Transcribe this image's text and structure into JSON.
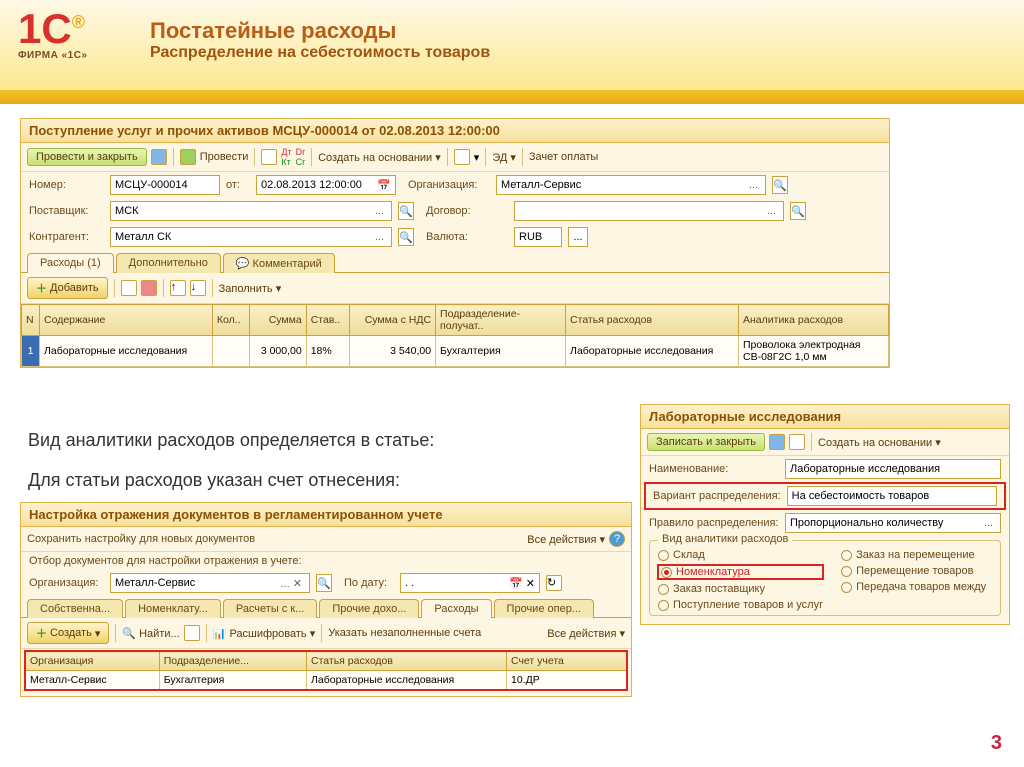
{
  "logo_sub": "ФИРМА «1С»",
  "slide": {
    "title1": "Постатейные расходы",
    "title2": "Распределение на себестоимость товаров",
    "text1": "Вид аналитики расходов определяется в статье:",
    "text2": "Для статьи расходов указан счет отнесения:",
    "page": "3"
  },
  "doc": {
    "title": "Поступление услуг и прочих активов МСЦУ-000014 от 02.08.2013 12:00:00",
    "btn_main": "Провести и закрыть",
    "btn_provesti": "Провести",
    "btn_create": "Создать на основании",
    "btn_ed": "ЭД",
    "btn_zachet": "Зачет оплаты",
    "lbl_number": "Номер:",
    "number": "МСЦУ-000014",
    "lbl_ot": "от:",
    "date": "02.08.2013 12:00:00",
    "lbl_org": "Организация:",
    "org": "Металл-Сервис",
    "lbl_supplier": "Поставщик:",
    "supplier": "МСК",
    "lbl_contract": "Договор:",
    "lbl_contragent": "Контрагент:",
    "contragent": "Металл СК",
    "lbl_currency": "Валюта:",
    "currency": "RUB",
    "tabs": [
      "Расходы (1)",
      "Дополнительно",
      "Комментарий"
    ],
    "btn_add": "Добавить",
    "btn_fill": "Заполнить",
    "cols": [
      "N",
      "Содержание",
      "Кол..",
      "Сумма",
      "Став..",
      "Сумма с НДС",
      "Подразделение-получат..",
      "Статья расходов",
      "Аналитика расходов"
    ],
    "row": {
      "n": "1",
      "content": "Лабораторные исследования",
      "kol": "",
      "sum": "3 000,00",
      "rate": "18%",
      "sum_nds": "3 540,00",
      "dept": "Бухгалтерия",
      "article": "Лабораторные исследования",
      "analytics": "Проволока электродная СВ-08Г2С 1,0 мм"
    }
  },
  "art": {
    "title": "Лабораторные исследования",
    "btn_save": "Записать и закрыть",
    "btn_create": "Создать на основании",
    "lbl_name": "Наименование:",
    "name": "Лабораторные исследования",
    "lbl_variant": "Вариант распределения:",
    "variant": "На себестоимость товаров",
    "lbl_rule": "Правило распределения:",
    "rule": "Пропорционально количеству",
    "grp_title": "Вид аналитики расходов",
    "radios_l": [
      "Склад",
      "Номенклатура",
      "Заказ поставщику",
      "Поступление товаров и услуг"
    ],
    "radios_r": [
      "Заказ на перемещение",
      "Перемещение товаров",
      "Передача товаров между"
    ]
  },
  "cfg": {
    "title": "Настройка отражения документов в регламентированном учете",
    "save_hint": "Сохранить настройку для новых документов",
    "all_actions": "Все действия",
    "filter_lbl": "Отбор документов для настройки отражения в учете:",
    "lbl_org": "Организация:",
    "org": "Металл-Сервис",
    "lbl_date": "По дату:",
    "date": ". .",
    "tabs": [
      "Собственна...",
      "Номенклату...",
      "Расчеты с к...",
      "Прочие дохо...",
      "Расходы",
      "Прочие опер..."
    ],
    "btn_create": "Создать",
    "btn_find": "Найти...",
    "btn_decode": "Расшифровать",
    "btn_unfilled": "Указать незаполненные счета",
    "cols": [
      "Организация",
      "Подразделение...",
      "Статья расходов",
      "Счет учета"
    ],
    "row": {
      "org": "Металл-Сервис",
      "dept": "Бухгалтерия",
      "article": "Лабораторные исследования",
      "account": "10.ДР"
    }
  }
}
